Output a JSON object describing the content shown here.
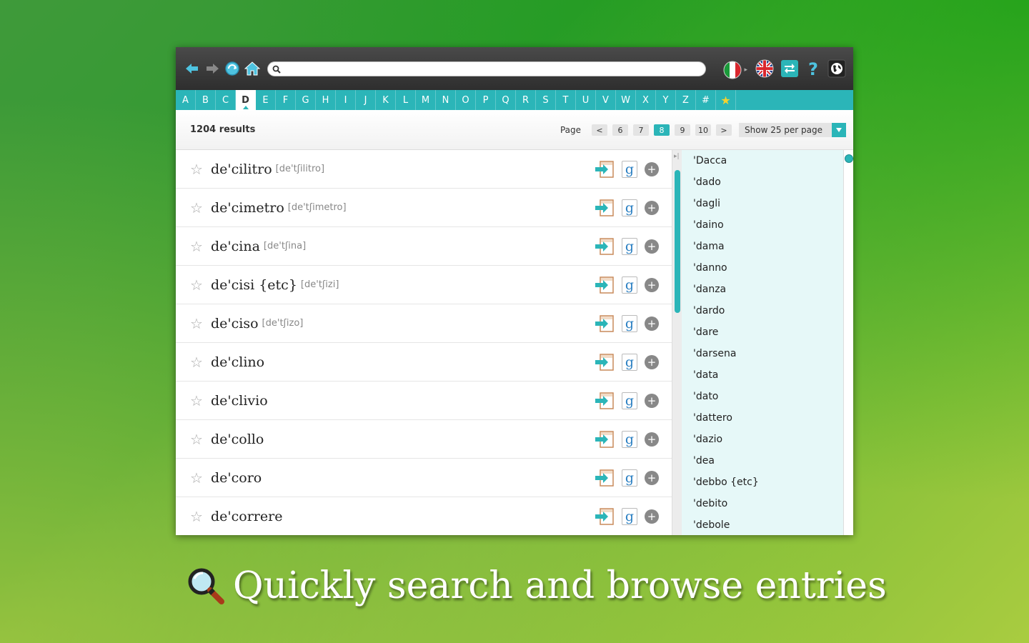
{
  "toolbar": {
    "search_value": "",
    "icons": [
      "back-arrow-icon",
      "forward-arrow-icon",
      "refresh-globe-icon",
      "home-icon",
      "search-icon",
      "italian-flag-icon",
      "uk-flag-icon",
      "swap-icon",
      "help-icon",
      "globe-icon"
    ]
  },
  "alphabet": {
    "letters": [
      "A",
      "B",
      "C",
      "D",
      "E",
      "F",
      "G",
      "H",
      "I",
      "J",
      "K",
      "L",
      "M",
      "N",
      "O",
      "P",
      "Q",
      "R",
      "S",
      "T",
      "U",
      "V",
      "W",
      "X",
      "Y",
      "Z",
      "#"
    ],
    "active": "D",
    "favorites_icon": "star-icon"
  },
  "results": {
    "count_label": "1204 results",
    "page_label": "Page",
    "prev": "<",
    "next": ">",
    "pages": [
      "6",
      "7",
      "8",
      "9",
      "10"
    ],
    "current_page": "8",
    "per_page_label": "Show 25 per page"
  },
  "entries": [
    {
      "word": "de'cilitro",
      "pron": "[de'tʃilitro]"
    },
    {
      "word": "de'cimetro",
      "pron": "[de'tʃimetro]"
    },
    {
      "word": "de'cina",
      "pron": "[de'tʃina]"
    },
    {
      "word": "de'cisi {etc}",
      "pron": "[de'tʃizi]"
    },
    {
      "word": "de'ciso",
      "pron": "[de'tʃizo]"
    },
    {
      "word": "de'clino",
      "pron": ""
    },
    {
      "word": "de'clivio",
      "pron": ""
    },
    {
      "word": "de'collo",
      "pron": ""
    },
    {
      "word": "de'coro",
      "pron": ""
    },
    {
      "word": "de'correre",
      "pron": ""
    }
  ],
  "entry_actions": {
    "google_label": "g",
    "plus_label": "+"
  },
  "sidebar": {
    "items": [
      "'Dacca",
      "'dado",
      "'dagli",
      "'daino",
      "'dama",
      "'danno",
      "'danza",
      "'dardo",
      "'dare",
      "'darsena",
      "'data",
      "'dato",
      "'dattero",
      "'dazio",
      "'dea",
      "'debbo {etc}",
      "'debito",
      "'debole"
    ]
  },
  "colors": {
    "accent": "#2bb5b8",
    "toolbar": "#3a3a3a",
    "sidebar_bg": "#e6f8f8"
  },
  "tagline": {
    "text": "Quickly search and browse entries"
  }
}
